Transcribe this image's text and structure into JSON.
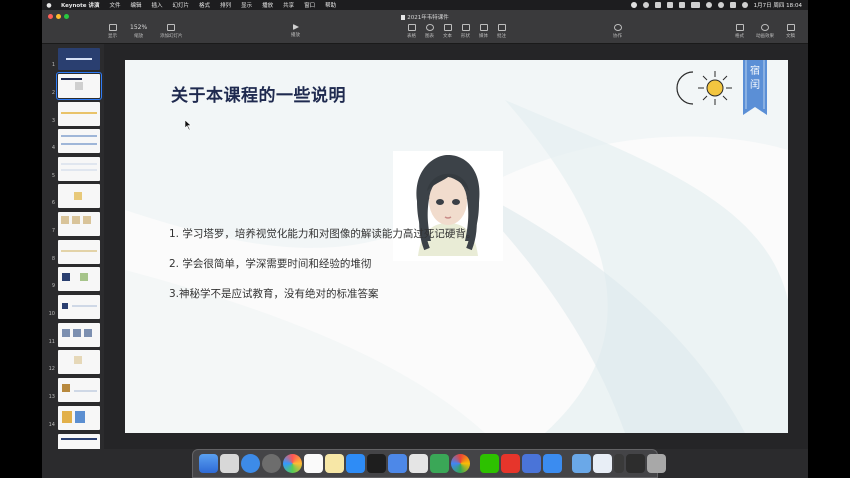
{
  "menubar": {
    "app": "Keynote 讲演",
    "items": [
      "文件",
      "编辑",
      "插入",
      "幻灯片",
      "格式",
      "排列",
      "显示",
      "播放",
      "共享",
      "窗口",
      "帮助"
    ],
    "clock": "1月7日 周四  18:04"
  },
  "window": {
    "title": "2021年韦特课件"
  },
  "toolbar": {
    "zoom_value": "152%",
    "view_label": "显示",
    "zoom_label": "缩放",
    "add_slide_label": "添加幻灯片",
    "play_label": "播放",
    "table_label": "表格",
    "chart_label": "图表",
    "text_label": "文本",
    "shape_label": "形状",
    "media_label": "媒体",
    "comment_label": "批注",
    "share_label": "协作",
    "format_label": "格式",
    "animate_label": "动画效果",
    "document_label": "文稿"
  },
  "slides": {
    "numbers": [
      "1",
      "2",
      "3",
      "4",
      "5",
      "6",
      "7",
      "8",
      "9",
      "10",
      "11",
      "12",
      "13",
      "14"
    ],
    "selected_index": 2
  },
  "slide": {
    "title": "关于本课程的一些说明",
    "bookmark_text": "宿闰",
    "points": [
      "1.  学习塔罗，培养视觉化能力和对图像的解读能力高过死记硬背。",
      "2.  学会很简单，学深需要时间和经验的堆彻",
      "3.神秘学不是应试教育，没有绝对的标准答案"
    ]
  },
  "colors": {
    "accent": "#2f7cf6",
    "title": "#1f2a4f",
    "bookmark": "#5b8fd6"
  }
}
